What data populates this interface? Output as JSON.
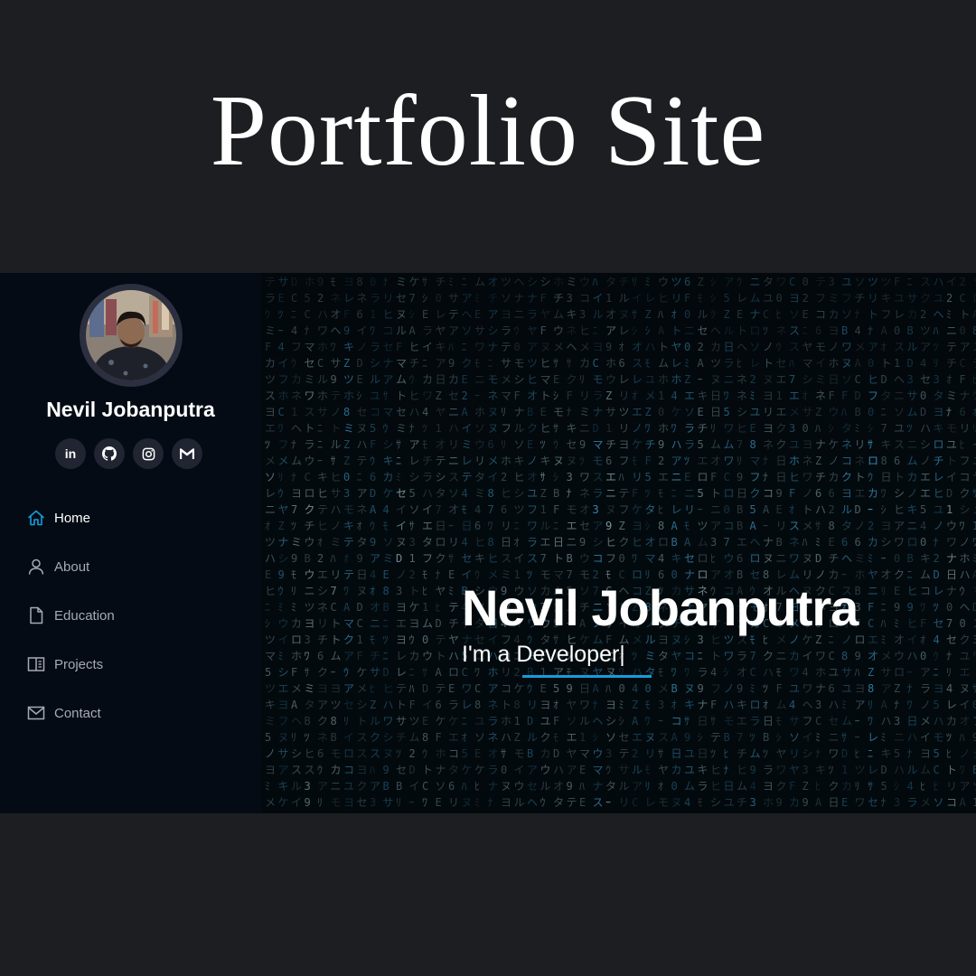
{
  "poster": {
    "title": "Portfolio Site"
  },
  "sidebar": {
    "name": "Nevil Jobanputra",
    "socials": [
      {
        "icon": "linkedin-icon",
        "label": "in"
      },
      {
        "icon": "github-icon"
      },
      {
        "icon": "instagram-icon"
      },
      {
        "icon": "gmail-icon"
      }
    ],
    "nav": [
      {
        "label": "Home",
        "icon": "home-icon",
        "active": true
      },
      {
        "label": "About",
        "icon": "user-icon"
      },
      {
        "label": "Education",
        "icon": "file-icon"
      },
      {
        "label": "Projects",
        "icon": "book-icon"
      },
      {
        "label": "Contact",
        "icon": "mail-icon"
      }
    ]
  },
  "hero": {
    "name": "Nevil Jobanputra",
    "subtitle": "I'm a Developer|"
  },
  "colors": {
    "background": "#1d1e22",
    "sidebar": "#040b14",
    "accent": "#149ddd",
    "nav_text": "#a8a9b4",
    "social_bg": "#212431"
  }
}
